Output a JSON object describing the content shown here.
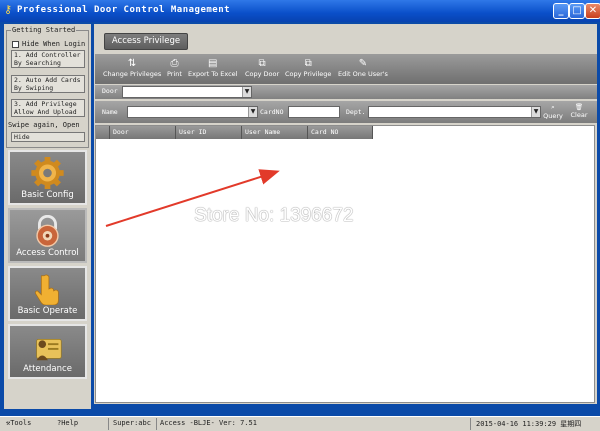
{
  "window": {
    "title": "Professional Door Control Management",
    "min": "_",
    "max": "□",
    "close": "✕"
  },
  "sidebar": {
    "getting_started_title": "Getting Started",
    "hide_when_login": "Hide When Login",
    "steps": [
      "1. Add Controller By Searching",
      "2. Auto Add Cards By Swiping",
      "3. Add Privilege Allow And Upload"
    ],
    "swipe_again": "Swipe again, Open",
    "hide_button": "Hide",
    "nav": [
      {
        "label": "Basic Config",
        "icon": "gear-icon"
      },
      {
        "label": "Access Control",
        "icon": "lock-icon"
      },
      {
        "label": "Basic Operate",
        "icon": "hand-pointer-icon"
      },
      {
        "label": "Attendance",
        "icon": "person-card-icon"
      }
    ]
  },
  "main": {
    "tab_label": "Access Privilege",
    "toolbar": [
      {
        "label": "Change Privileges",
        "icon": "change-icon"
      },
      {
        "label": "Print",
        "icon": "printer-icon"
      },
      {
        "label": "Export To Excel",
        "icon": "excel-icon"
      },
      {
        "label": "Copy Door",
        "icon": "copy-door-icon"
      },
      {
        "label": "Copy Privilege",
        "icon": "copy-privilege-icon"
      },
      {
        "label": "Edit One User's",
        "icon": "edit-icon"
      }
    ],
    "door_label": "Door",
    "door_value": "",
    "search": {
      "name_label": "Name",
      "name_value": "",
      "card_label": "CardNO",
      "card_value": "",
      "dept_label": "Dept.",
      "dept_value": "",
      "query_label": "Query",
      "clear_label": "Clear"
    },
    "grid": {
      "columns": [
        "Door",
        "User ID",
        "User Name",
        "Card NO"
      ],
      "rows": []
    }
  },
  "overlay": {
    "watermark": "Store No: 1396672",
    "arrow_color": "#e23a2a"
  },
  "status_bar": {
    "tools": "Tools",
    "help": "Help",
    "user": "Super:abc",
    "version": "Access -BLJE- Ver: 7.51",
    "datetime": "2015-04-16 11:39:29 星期四"
  }
}
